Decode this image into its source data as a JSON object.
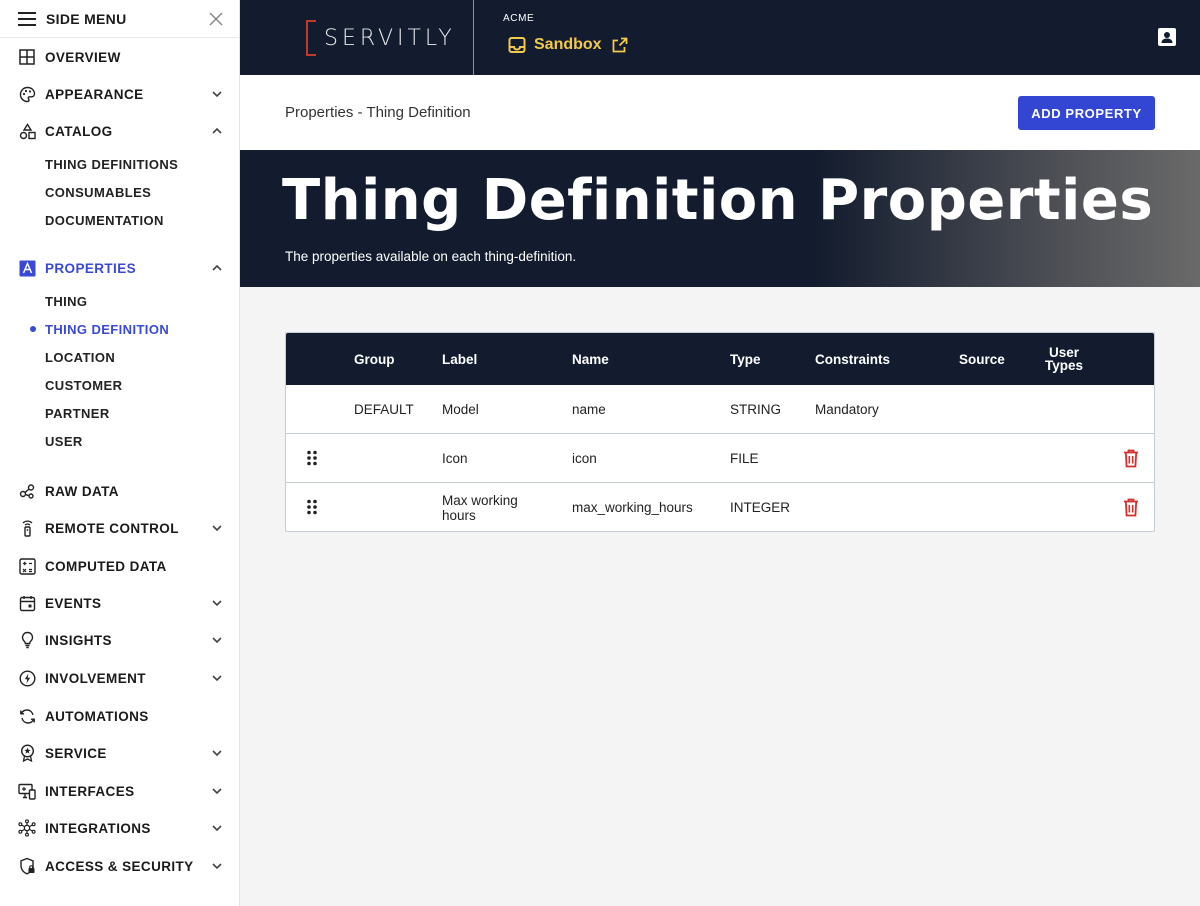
{
  "sidebar": {
    "title": "SIDE MENU",
    "items": [
      {
        "label": "OVERVIEW",
        "icon": "grid-icon"
      },
      {
        "label": "APPEARANCE",
        "icon": "palette-icon"
      },
      {
        "label": "CATALOG",
        "icon": "shapes-icon"
      },
      {
        "label": "PROPERTIES",
        "icon": "properties-icon"
      },
      {
        "label": "RAW DATA",
        "icon": "nodes-icon"
      },
      {
        "label": "REMOTE CONTROL",
        "icon": "remote-icon"
      },
      {
        "label": "COMPUTED DATA",
        "icon": "calculator-icon"
      },
      {
        "label": "EVENTS",
        "icon": "calendar-icon"
      },
      {
        "label": "INSIGHTS",
        "icon": "lightbulb-icon"
      },
      {
        "label": "INVOLVEMENT",
        "icon": "bolt-icon"
      },
      {
        "label": "AUTOMATIONS",
        "icon": "refresh-icon"
      },
      {
        "label": "SERVICE",
        "icon": "badge-icon"
      },
      {
        "label": "INTERFACES",
        "icon": "devices-icon"
      },
      {
        "label": "INTEGRATIONS",
        "icon": "hub-icon"
      },
      {
        "label": "ACCESS & SECURITY",
        "icon": "shield-lock-icon"
      }
    ],
    "catalog_sub": [
      "THING DEFINITIONS",
      "CONSUMABLES",
      "DOCUMENTATION"
    ],
    "properties_sub": [
      "THING",
      "THING DEFINITION",
      "LOCATION",
      "CUSTOMER",
      "PARTNER",
      "USER"
    ]
  },
  "topbar": {
    "logo": "SERVITLY",
    "tenant": "ACME",
    "environment": "Sandbox"
  },
  "page": {
    "breadcrumb": "Properties - Thing Definition",
    "add_button": "ADD PROPERTY",
    "title": "Thing Definition Properties",
    "subtitle": "The properties available on each thing-definition."
  },
  "table": {
    "columns": {
      "group": "Group",
      "label": "Label",
      "name": "Name",
      "type": "Type",
      "constraints": "Constraints",
      "source": "Source",
      "user_types_1": "User",
      "user_types_2": "Types"
    },
    "rows": [
      {
        "group": "DEFAULT",
        "label": "Model",
        "name": "name",
        "type": "STRING",
        "constraints": "Mandatory",
        "source": "",
        "user_types": ""
      },
      {
        "group": "",
        "label": "Icon",
        "name": "icon",
        "type": "FILE",
        "constraints": "",
        "source": "",
        "user_types": ""
      },
      {
        "group": "",
        "label": "Max working hours",
        "name": "max_working_hours",
        "type": "INTEGER",
        "constraints": "",
        "source": "",
        "user_types": ""
      }
    ]
  },
  "colors": {
    "navy": "#131c2e",
    "accent_blue": "#3346d3",
    "active_nav": "#3a48d6",
    "sandbox_yellow": "#f2c94c",
    "delete_red": "#d32f2f"
  }
}
